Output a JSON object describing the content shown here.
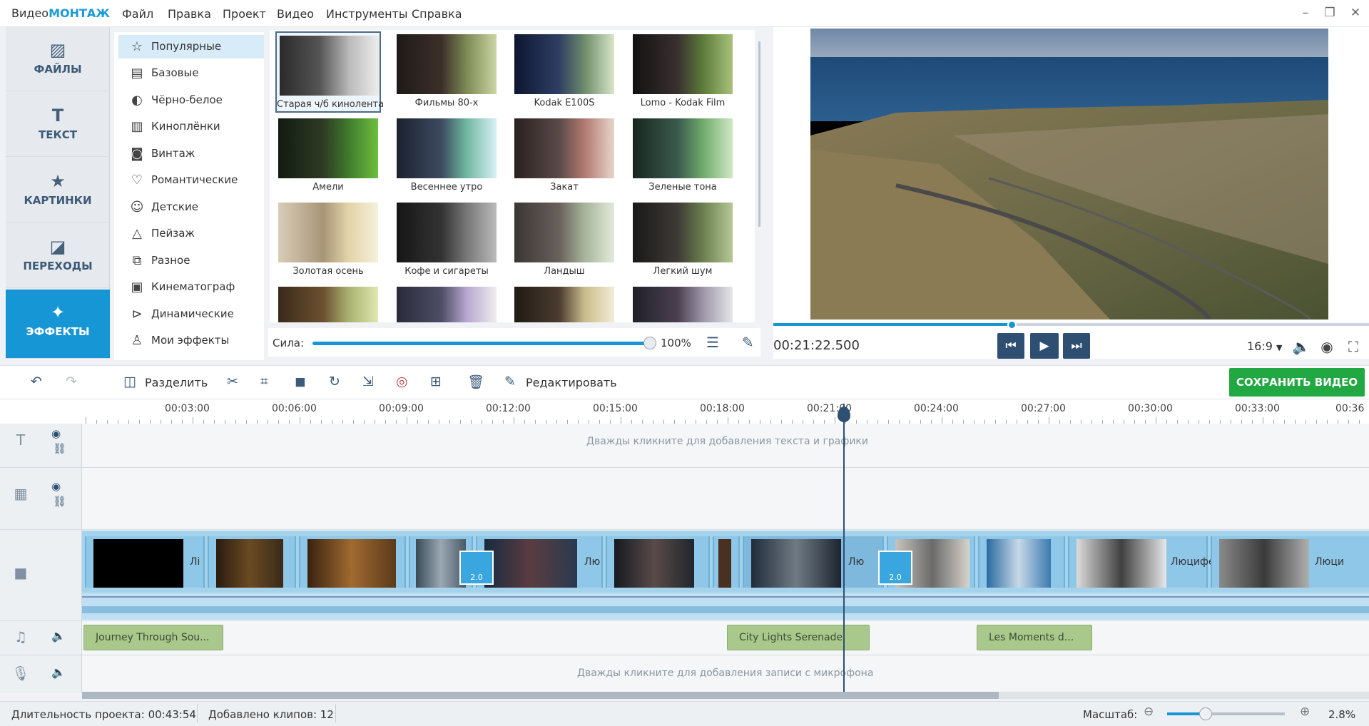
{
  "app": {
    "name_part1": "Видео",
    "name_part2": "МОНТАЖ"
  },
  "menu": [
    "Файл",
    "Правка",
    "Проект",
    "Видео",
    "Инструменты",
    "Справка"
  ],
  "categories": [
    {
      "label": "ФАЙЛЫ",
      "icon": "image-icon"
    },
    {
      "label": "ТЕКСТ",
      "icon": "text-icon"
    },
    {
      "label": "КАРТИНКИ",
      "icon": "star-icon"
    },
    {
      "label": "ПЕРЕХОДЫ",
      "icon": "transition-icon"
    },
    {
      "label": "ЭФФЕКТЫ",
      "icon": "effects-icon",
      "active": true
    }
  ],
  "effect_categories": [
    "Популярные",
    "Базовые",
    "Чёрно-белое",
    "Киноплёнки",
    "Винтаж",
    "Романтические",
    "Детские",
    "Пейзаж",
    "Разное",
    "Кинематограф",
    "Динамические",
    "Мои эффекты"
  ],
  "effects": [
    "Старая ч/б кинолента",
    "Фильмы 80-х",
    "Kodak E100S",
    "Lomo - Kodak Film",
    "Амели",
    "Весеннее утро",
    "Закат",
    "Зеленые тона",
    "Золотая осень",
    "Кофе и сигареты",
    "Ландыш",
    "Легкий шум"
  ],
  "strength": {
    "label": "Сила:",
    "value": "100%",
    "level": 1.0
  },
  "preview": {
    "time": "00:21:22.500",
    "ratio": "16:9",
    "progress": 0.4
  },
  "toolbar": {
    "split": "Разделить",
    "edit": "Редактировать",
    "save": "СОХРАНИТЬ ВИДЕО"
  },
  "ruler": [
    "00:03:00",
    "00:06:00",
    "00:09:00",
    "00:12:00",
    "00:15:00",
    "00:18:00",
    "00:21:00",
    "00:24:00",
    "00:27:00",
    "00:30:00",
    "00:33:00",
    "00:36"
  ],
  "hints": {
    "text": "Дважды кликните для добавления текста и графики",
    "mic": "Дважды кликните для добавления записи с микрофона"
  },
  "clip_labels": [
    "Лі",
    "Лю",
    "Лю",
    "Люцифе",
    "Люци"
  ],
  "transition_label": "2.0",
  "music": [
    "Journey Through Sou...",
    "City Lights Serenade",
    "Les Moments d..."
  ],
  "status": {
    "duration": "Длительность проекта: 00:43:54",
    "clips": "Добавлено клипов: 12",
    "zoom_label": "Масштаб:",
    "zoom_value": "2.8%",
    "zoom_level": 0.33
  }
}
